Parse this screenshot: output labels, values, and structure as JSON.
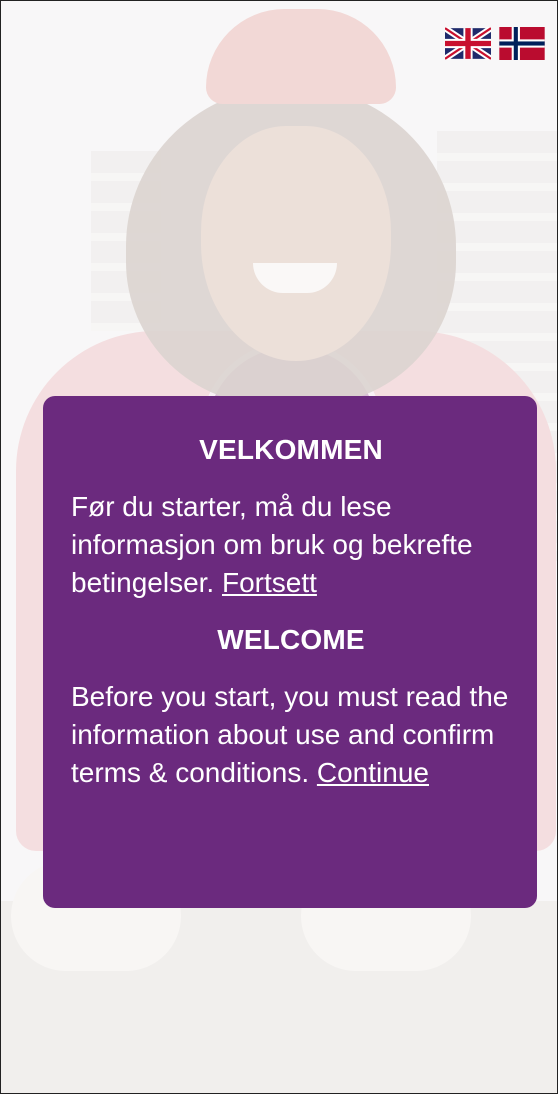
{
  "languages": {
    "english": "english-flag-icon",
    "norwegian": "norwegian-flag-icon"
  },
  "colors": {
    "card_background": "#6b2a7e",
    "card_text": "#ffffff"
  },
  "welcome_card": {
    "norwegian": {
      "title": "VELKOMMEN",
      "body": "Før du starter, må du lese informasjon om bruk og bekrefte betingelser.",
      "link": "Fortsett"
    },
    "english": {
      "title": "WELCOME",
      "body": "Before you start, you must read the information about use and confirm terms & conditions.",
      "link": "Continue"
    }
  }
}
